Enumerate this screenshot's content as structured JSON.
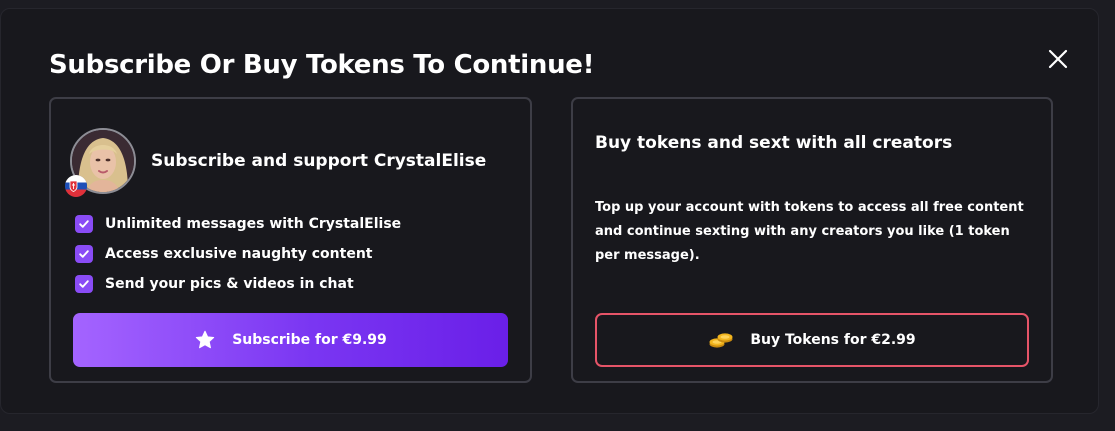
{
  "modal": {
    "title": "Subscribe Or Buy Tokens To Continue!",
    "close_icon": "close-icon"
  },
  "subscribe_card": {
    "heading": "Subscribe and support CrystalElise",
    "avatar_flag": "slovakia-flag-icon",
    "benefits": [
      {
        "label": "Unlimited messages with CrystalElise",
        "icon": "checkbox-checked-icon"
      },
      {
        "label": "Access exclusive naughty content",
        "icon": "checkbox-checked-icon"
      },
      {
        "label": "Send your pics & videos in chat",
        "icon": "checkbox-checked-icon"
      }
    ],
    "button_label": "Subscribe for €9.99",
    "button_icon": "star-icon"
  },
  "tokens_card": {
    "heading": "Buy tokens and sext with all creators",
    "description": "Top up your account with tokens to access all free content and continue sexting with any creators you like (1 token per message).",
    "button_label": "Buy Tokens for €2.99",
    "button_icon": "coins-icon"
  },
  "colors": {
    "modal_background": "#18181d",
    "card_border": "#3d3d46",
    "checkbox_purple": "#8a4cf6",
    "subscribe_gradient_start": "#a464ff",
    "subscribe_gradient_end": "#6a1fe8",
    "buy_button_border": "#e65468",
    "coin_gold": "#f2b51e"
  }
}
